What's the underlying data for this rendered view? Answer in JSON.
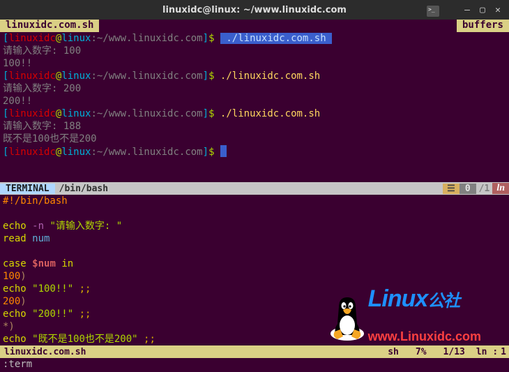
{
  "window": {
    "title": "linuxidc@linux: ~/www.linuxidc.com",
    "tab_icon": ">_"
  },
  "topstrip": {
    "buffer_tab": "linuxidc.com.sh",
    "buffers_label": "buffers"
  },
  "prompt": {
    "open": "[",
    "user": "linuxidc",
    "at": "@",
    "host": "linux",
    "colon": ":",
    "path": "~/www.linuxidc.com",
    "close": "]$ "
  },
  "terminal": [
    {
      "type": "prompt_hl",
      "cmd": "./linuxidc.com.sh "
    },
    {
      "type": "out",
      "text": "请输入数字: 100"
    },
    {
      "type": "out",
      "text": "100!!"
    },
    {
      "type": "prompt",
      "cmd": "./linuxidc.com.sh"
    },
    {
      "type": "out",
      "text": "请输入数字: 200"
    },
    {
      "type": "out",
      "text": "200!!"
    },
    {
      "type": "prompt",
      "cmd": "./linuxidc.com.sh"
    },
    {
      "type": "out",
      "text": "请输入数字: 188"
    },
    {
      "type": "out",
      "text": "既不是100也不是200"
    },
    {
      "type": "prompt_cursor"
    }
  ],
  "status_top": {
    "mode": "TERMINAL",
    "file": "/bin/bash",
    "hamburger": "☰",
    "num": "0",
    "total": "/1",
    "ln": "ln"
  },
  "script": {
    "lines": [
      {
        "t": "shebang",
        "text": "#!/bin/bash"
      },
      {
        "t": "blank"
      },
      {
        "t": "echo_flag",
        "kw": "echo",
        "flag": "-n",
        "str": "\"请输入数字: \""
      },
      {
        "t": "read",
        "kw": "read",
        "arg": "num"
      },
      {
        "t": "blank"
      },
      {
        "t": "case",
        "kw1": "case",
        "var": "$num",
        "kw2": "in"
      },
      {
        "t": "branch",
        "val": "100",
        "paren": ")"
      },
      {
        "t": "echo_term",
        "kw": "echo",
        "str": "\"100!!\"",
        "term": ";;"
      },
      {
        "t": "branch",
        "val": "200",
        "paren": ")"
      },
      {
        "t": "echo_term",
        "kw": "echo",
        "str": "\"200!!\"",
        "term": ";;"
      },
      {
        "t": "default",
        "star": "*",
        "paren": ")"
      },
      {
        "t": "echo_term",
        "kw": "echo",
        "str": "\"既不是100也不是200\"",
        "term": ";;"
      }
    ]
  },
  "status_bottom": {
    "file": "linuxidc.com.sh",
    "ft": "sh",
    "pct": "7%",
    "pos": "1/13",
    "ln_label": "ln :",
    "col": "1"
  },
  "cmdline": ":term",
  "logo": {
    "brand": "Linux",
    "suffix": "公社",
    "url": "www.Linuxidc.com"
  }
}
